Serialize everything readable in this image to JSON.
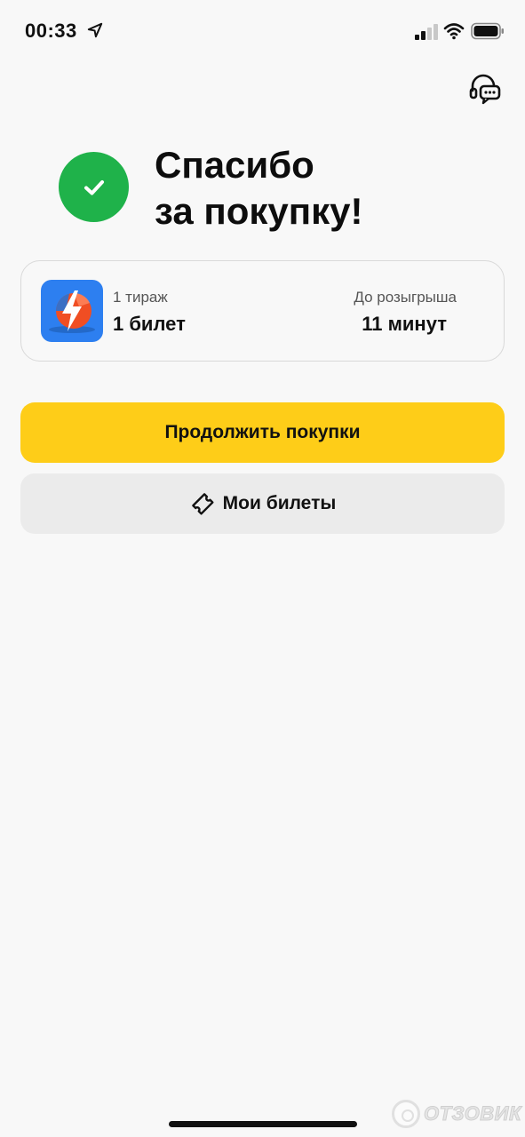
{
  "status_bar": {
    "time": "00:33"
  },
  "icons": {
    "location": "location-arrow-icon",
    "signal": "cellular-signal-icon",
    "wifi": "wifi-icon",
    "battery": "battery-icon",
    "support": "support-chat-icon",
    "success": "checkmark-icon",
    "ticket": "ticket-icon",
    "lottery": "lottery-bolt-logo"
  },
  "header": {
    "title_line1": "Спасибо",
    "title_line2": "за покупку!"
  },
  "ticket_card": {
    "draw_label": "1 тираж",
    "ticket_count": "1 билет",
    "until_label": "До розыгрыша",
    "time_left": "11 минут"
  },
  "actions": {
    "continue_label": "Продолжить покупки",
    "my_tickets_label": "Мои билеты"
  },
  "watermark": {
    "text": "ОТЗОВИК"
  },
  "colors": {
    "background": "#f8f8f8",
    "success_green": "#1fb24a",
    "primary_yellow": "#fecd18",
    "secondary_gray": "#ebebeb",
    "logo_blue": "#2d7ff0",
    "logo_orange": "#f04e23"
  }
}
